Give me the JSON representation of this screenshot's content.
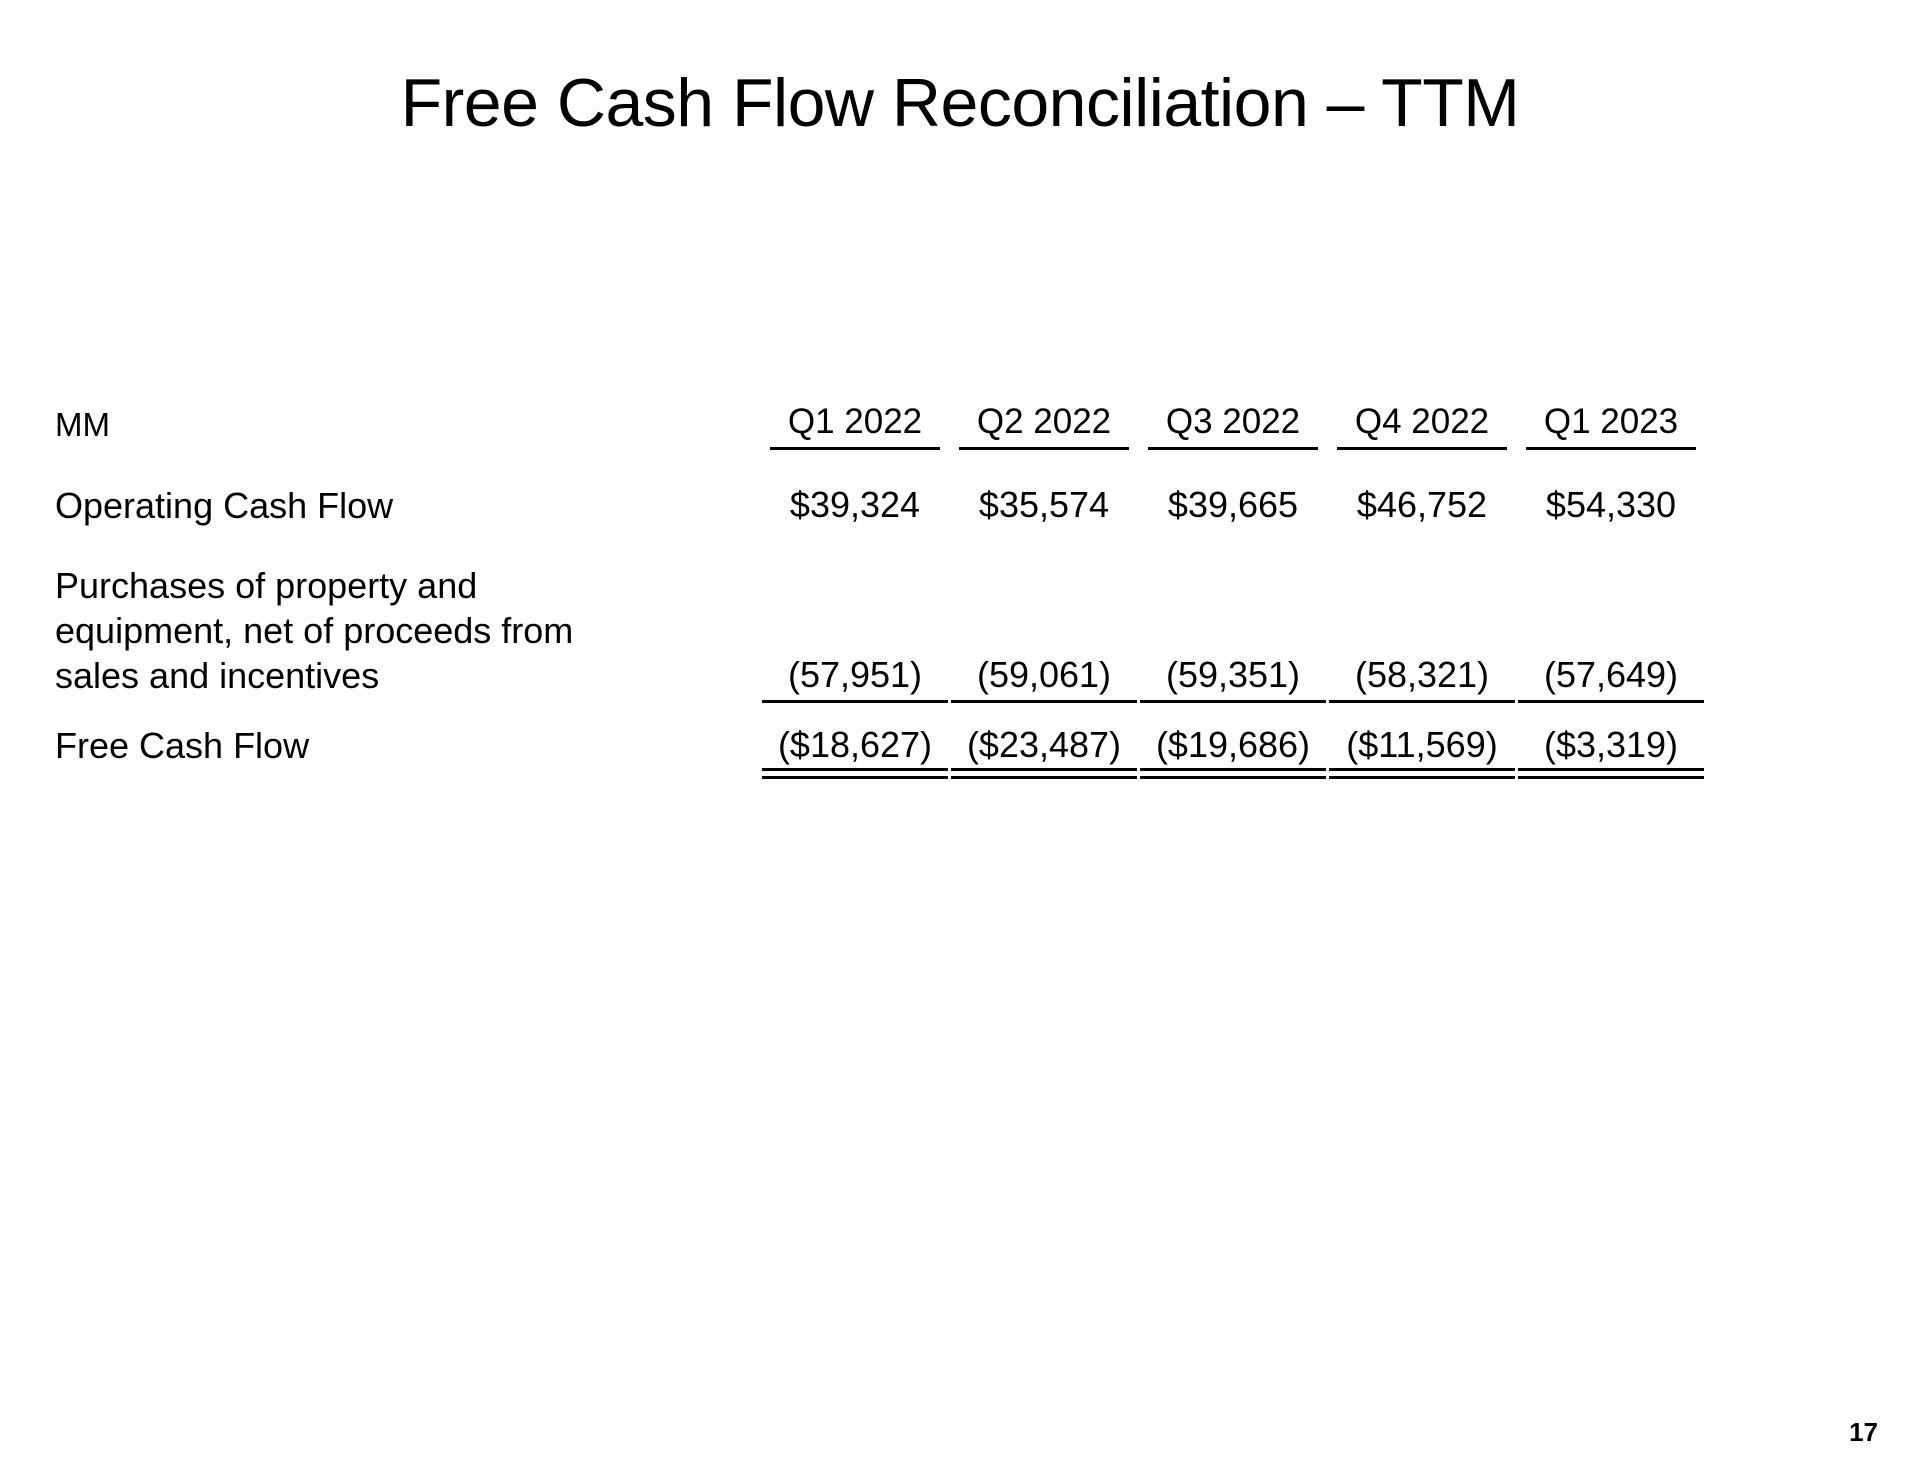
{
  "slide": {
    "title": "Free Cash Flow Reconciliation – TTM",
    "page_number": "17",
    "unit_label": "MM",
    "background_color": "#ffffff",
    "text_color": "#000000"
  },
  "table": {
    "unit_label": "MM",
    "columns": [
      "Q1 2022",
      "Q2 2022",
      "Q3 2022",
      "Q4 2022",
      "Q1 2023"
    ],
    "rows": [
      {
        "label": "Operating Cash Flow",
        "values": [
          "$39,324",
          "$35,574",
          "$39,665",
          "$46,752",
          "$54,330"
        ],
        "rule": "none"
      },
      {
        "label": "Purchases of property and\nequipment, net of proceeds from\nsales and incentives",
        "values": [
          "(57,951)",
          "(59,061)",
          "(59,351)",
          "(58,321)",
          "(57,649)"
        ],
        "rule": "single"
      },
      {
        "label": "Free Cash Flow",
        "values": [
          "($18,627)",
          "($23,487)",
          "($19,686)",
          "($11,569)",
          "($3,319)"
        ],
        "rule": "double"
      }
    ]
  },
  "chart_data": {
    "type": "table",
    "title": "Free Cash Flow Reconciliation – TTM",
    "subtitle": "MM",
    "categories": [
      "Q1 2022",
      "Q2 2022",
      "Q3 2022",
      "Q4 2022",
      "Q1 2023"
    ],
    "series": [
      {
        "name": "Operating Cash Flow",
        "values": [
          39324,
          35574,
          39665,
          46752,
          54330
        ],
        "display": [
          "$39,324",
          "$35,574",
          "$39,665",
          "$46,752",
          "$54,330"
        ]
      },
      {
        "name": "Purchases of property and equipment, net of proceeds from sales and incentives",
        "values": [
          -57951,
          -59061,
          -59351,
          -58321,
          -57649
        ],
        "display": [
          "(57,951)",
          "(59,061)",
          "(59,351)",
          "(58,321)",
          "(57,649)"
        ]
      },
      {
        "name": "Free Cash Flow",
        "values": [
          -18627,
          -23487,
          -19686,
          -11569,
          -3319
        ],
        "display": [
          "($18,627)",
          "($23,487)",
          "($19,686)",
          "($11,569)",
          "($3,319)"
        ]
      }
    ],
    "units": "MM",
    "xlabel": "",
    "ylabel": "",
    "grid": false,
    "legend": "none"
  }
}
